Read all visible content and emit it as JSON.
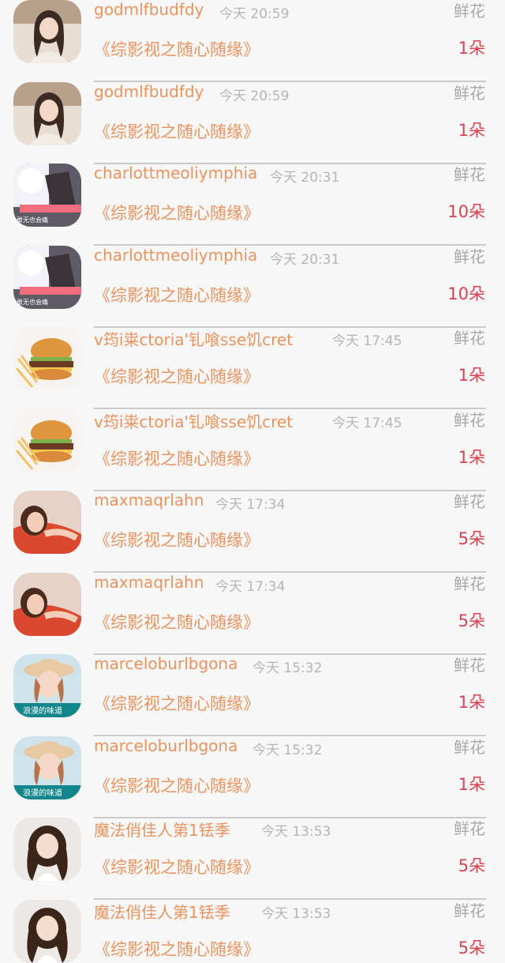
{
  "gift_list": {
    "rows": [
      {
        "user": "godmlfbudfdy",
        "time": "今天 20:59",
        "gift": "鲜花",
        "work": "《综影视之随心随缘》",
        "amount": "1朵",
        "avatar_icon": "girl-avatar-icon"
      },
      {
        "user": "godmlfbudfdy",
        "time": "今天 20:59",
        "gift": "鲜花",
        "work": "《综影视之随心随缘》",
        "amount": "1朵",
        "avatar_icon": "girl-avatar-icon"
      },
      {
        "user": "charlottmeoliymphia",
        "time": "今天 20:31",
        "gift": "鲜花",
        "work": "《综影视之随心随缘》",
        "amount": "10朵",
        "avatar_icon": "photo-avatar-icon",
        "avatar_caption": "敢无也会痛"
      },
      {
        "user": "charlottmeoliymphia",
        "time": "今天 20:31",
        "gift": "鲜花",
        "work": "《综影视之随心随缘》",
        "amount": "10朵",
        "avatar_icon": "photo-avatar-icon",
        "avatar_caption": "敢无也会痛"
      },
      {
        "user": "v筠i粜ctoria'钆喰sse饥cret",
        "time": "今天 17:45",
        "gift": "鲜花",
        "work": "《综影视之随心随缘》",
        "amount": "1朵",
        "avatar_icon": "burger-avatar-icon"
      },
      {
        "user": "v筠i粜ctoria'钆喰sse饥cret",
        "time": "今天 17:45",
        "gift": "鲜花",
        "work": "《综影视之随心随缘》",
        "amount": "1朵",
        "avatar_icon": "burger-avatar-icon"
      },
      {
        "user": "maxmaqrlahn",
        "time": "今天 17:34",
        "gift": "鲜花",
        "work": "《综影视之随心随缘》",
        "amount": "5朵",
        "avatar_icon": "woman-avatar-icon"
      },
      {
        "user": "maxmaqrlahn",
        "time": "今天 17:34",
        "gift": "鲜花",
        "work": "《综影视之随心随缘》",
        "amount": "5朵",
        "avatar_icon": "woman-avatar-icon"
      },
      {
        "user": "marceloburlbgona",
        "time": "今天 15:32",
        "gift": "鲜花",
        "work": "《综影视之随心随缘》",
        "amount": "1朵",
        "avatar_icon": "hat-girl-avatar-icon",
        "avatar_caption": "浪漫的味道"
      },
      {
        "user": "marceloburlbgona",
        "time": "今天 15:32",
        "gift": "鲜花",
        "work": "《综影视之随心随缘》",
        "amount": "1朵",
        "avatar_icon": "hat-girl-avatar-icon",
        "avatar_caption": "浪漫的味道"
      },
      {
        "user": "魔法俏佳人第1铥季",
        "time": "今天 13:53",
        "gift": "鲜花",
        "work": "《综影视之随心随缘》",
        "amount": "5朵",
        "avatar_icon": "curly-girl-avatar-icon"
      },
      {
        "user": "魔法俏佳人第1铥季",
        "time": "今天 13:53",
        "gift": "鲜花",
        "work": "《综影视之随心随缘》",
        "amount": "5朵",
        "avatar_icon": "curly-girl-avatar-icon"
      }
    ]
  },
  "colors": {
    "username": "#e9935e",
    "amount": "#d8424f",
    "muted": "#b5b5b5",
    "background": "#f7f7f7"
  }
}
